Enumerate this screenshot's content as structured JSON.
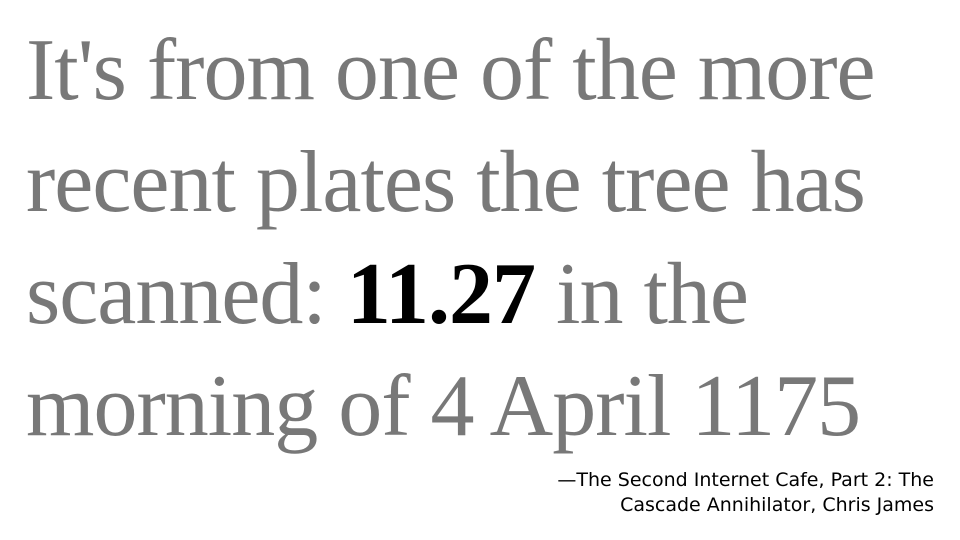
{
  "quote": {
    "line1": "It's from one of the more",
    "line2": "recent plates the tree has",
    "line3_before": "scanned: ",
    "line3_highlight": "11.27",
    "line3_after": " in the",
    "line4": "morning of 4 April 1175"
  },
  "attribution": {
    "line1": "—The Second Internet Cafe, Part 2: The",
    "line2": "Cascade Annihilator, Chris James"
  },
  "colors": {
    "quote_text": "#787878",
    "highlight_text": "#000000",
    "attribution_text": "#000000",
    "background": "#ffffff"
  }
}
